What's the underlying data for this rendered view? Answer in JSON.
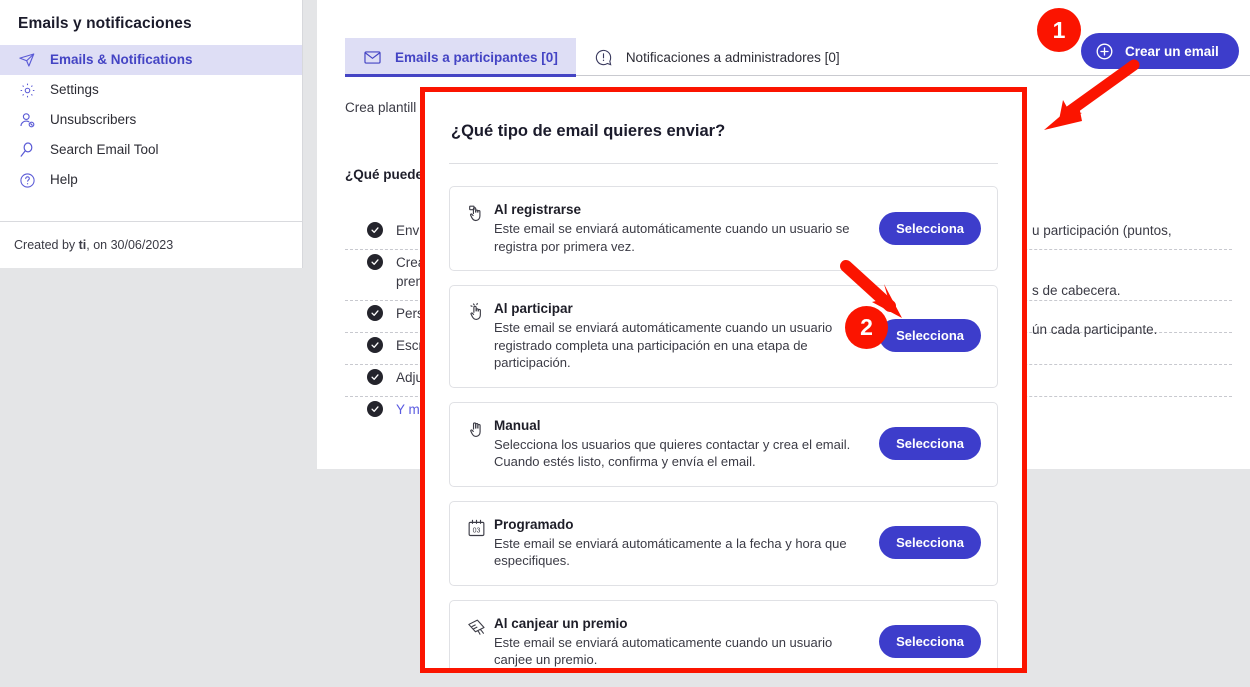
{
  "sidebar": {
    "title": "Emails y notificaciones",
    "items": [
      {
        "label": "Emails & Notifications",
        "icon": "paper-plane-icon",
        "active": true
      },
      {
        "label": "Settings",
        "icon": "gear-icon",
        "active": false
      },
      {
        "label": "Unsubscribers",
        "icon": "user-remove-icon",
        "active": false
      },
      {
        "label": "Search Email Tool",
        "icon": "magnifier-icon",
        "active": false
      },
      {
        "label": "Help",
        "icon": "question-circle-icon",
        "active": false
      }
    ],
    "footer_prefix": "Created by ",
    "footer_author": "ti",
    "footer_suffix": ", on 30/06/2023"
  },
  "tabs": [
    {
      "label": "Emails a participantes [0]",
      "icon": "envelope-icon",
      "active": true
    },
    {
      "label": "Notificaciones a administradores [0]",
      "icon": "alert-circle-icon",
      "active": false
    }
  ],
  "toolbar": {
    "create_label": "Crear un email",
    "create_icon": "plus-circle-icon"
  },
  "main": {
    "intro": "Crea plantill",
    "subheading": "¿Qué puede",
    "checklist": [
      {
        "left": "Envia",
        "right": ""
      },
      {
        "left": "Crear",
        "left2": "premi",
        "right": "u participación (puntos,"
      },
      {
        "left": "Perso",
        "right": "s de cabecera."
      },
      {
        "left": "Escrib",
        "right": "ún cada participante."
      },
      {
        "left": "Adjun",
        "right": ""
      },
      {
        "left": "Y mue",
        "right": "",
        "is_link": true
      }
    ]
  },
  "modal": {
    "title": "¿Qué tipo de email quieres enviar?",
    "select_label": "Selecciona",
    "options": [
      {
        "icon": "hand-register-icon",
        "title": "Al registrarse",
        "desc": "Este email se enviará automáticamente cuando un usuario se registra por primera vez."
      },
      {
        "icon": "hand-click-icon",
        "title": "Al participar",
        "desc": "Este email se enviará automáticamente cuando un usuario registrado completa una participación en una etapa de participación."
      },
      {
        "icon": "hand-manual-icon",
        "title": "Manual",
        "desc": "Selecciona los usuarios que quieres contactar y crea el email. Cuando estés listo, confirma y envía el email."
      },
      {
        "icon": "calendar-icon",
        "title": "Programado",
        "desc": "Este email se enviará automáticamente a la fecha y hora que especifiques."
      },
      {
        "icon": "gift-ticket-icon",
        "title": "Al canjear un premio",
        "desc": "Este email se enviará automaticamente cuando un usuario canjee un premio."
      }
    ]
  },
  "annotations": {
    "badge_1": "1",
    "badge_2": "2",
    "color": "#fb1400"
  },
  "colors": {
    "accent_blue": "#3d3dcb",
    "selected_nav_bg": "#dedef5",
    "nav_active_text": "#4444c4",
    "annotation_red": "#fb1400",
    "page_bg": "#e4e5e7"
  }
}
